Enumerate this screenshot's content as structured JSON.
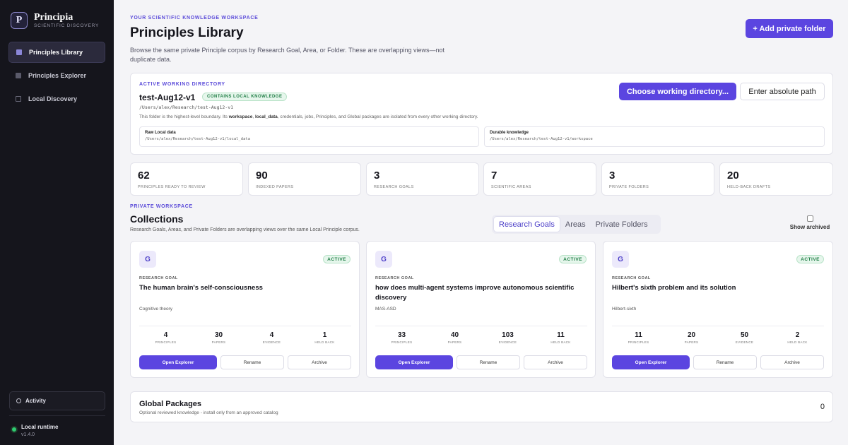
{
  "sidebar": {
    "brand": {
      "logo_letter": "P",
      "name": "Principia",
      "subtitle": "SCIENTIFIC DISCOVERY"
    },
    "nav": [
      {
        "label": "Principles Library",
        "icon": "library-icon",
        "active": true
      },
      {
        "label": "Principles Explorer",
        "icon": "explorer-icon",
        "active": false
      },
      {
        "label": "Local Discovery",
        "icon": "discovery-icon",
        "active": false
      }
    ],
    "activity_label": "Activity",
    "runtime": {
      "title": "Local runtime",
      "version": "v1.4.0",
      "status_color": "#2ecc71"
    }
  },
  "header": {
    "eyebrow": "YOUR SCIENTIFIC KNOWLEDGE WORKSPACE",
    "title": "Principles Library",
    "description": "Browse the same private Principle corpus by Research Goal, Area, or Folder. These are overlapping views—not duplicate data.",
    "add_folder_label": "+ Add private folder"
  },
  "working_directory": {
    "eyebrow": "ACTIVE WORKING DIRECTORY",
    "name": "test-Aug12-v1",
    "badge": "CONTAINS LOCAL KNOWLEDGE",
    "path": "/Users/alex/Research/test-Aug12-v1",
    "note_1": "This folder is the highest-level boundary. Its ",
    "note_b1": "workspace",
    "note_2": ", ",
    "note_b2": "local_data",
    "note_3": ", credentials, jobs, Principles, and Global packages are isolated from every other working directory.",
    "raw": {
      "title": "Raw Local data",
      "path": "/Users/alex/Research/test-Aug12-v1/local_data"
    },
    "durable": {
      "title": "Durable knowledge",
      "path": "/Users/alex/Research/test-Aug12-v1/workspace"
    },
    "choose_label": "Choose working directory...",
    "absolute_label": "Enter absolute path"
  },
  "stats": [
    {
      "value": "62",
      "label": "PRINCIPLES READY TO REVIEW"
    },
    {
      "value": "90",
      "label": "INDEXED PAPERS"
    },
    {
      "value": "3",
      "label": "RESEARCH GOALS"
    },
    {
      "value": "7",
      "label": "SCIENTIFIC AREAS"
    },
    {
      "value": "3",
      "label": "PRIVATE FOLDERS"
    },
    {
      "value": "20",
      "label": "HELD-BACK DRAFTS"
    }
  ],
  "collections": {
    "eyebrow": "PRIVATE WORKSPACE",
    "title": "Collections",
    "description": "Research Goals, Areas, and Private Folders are overlapping views over the same Local Principle corpus.",
    "tabs": [
      {
        "label": "Research Goals",
        "active": true
      },
      {
        "label": "Areas",
        "active": false
      },
      {
        "label": "Private Folders",
        "active": false
      }
    ],
    "show_archived_label": "Show archived",
    "stat_labels": {
      "principles": "PRINCIPLES",
      "papers": "PAPERS",
      "evidence": "EVIDENCE",
      "held_back": "HELD BACK"
    },
    "buttons": {
      "open": "Open Explorer",
      "rename": "Rename",
      "archive": "Archive"
    },
    "goals": [
      {
        "avatar": "G",
        "status": "ACTIVE",
        "type": "RESEARCH GOAL",
        "title": "The human brain's self-consciousness",
        "subtitle": "Cognitive theory",
        "principles": "4",
        "papers": "30",
        "evidence": "4",
        "held_back": "1"
      },
      {
        "avatar": "G",
        "status": "ACTIVE",
        "type": "RESEARCH GOAL",
        "title": "how does multi-agent systems improve autonomous scientific discovery",
        "subtitle": "MAS-ASD",
        "principles": "33",
        "papers": "40",
        "evidence": "103",
        "held_back": "11"
      },
      {
        "avatar": "G",
        "status": "ACTIVE",
        "type": "RESEARCH GOAL",
        "title": "Hilbert's sixth problem and its solution",
        "subtitle": "Hilbert-sixth",
        "principles": "11",
        "papers": "20",
        "evidence": "50",
        "held_back": "2"
      }
    ]
  },
  "global_packages": {
    "title": "Global Packages",
    "description": "Optional reviewed knowledge - install only from an approved catalog",
    "count": "0"
  },
  "colors": {
    "accent": "#5b45e0",
    "sidebar_bg": "#15151c",
    "active_badge": "#1e7d44"
  }
}
